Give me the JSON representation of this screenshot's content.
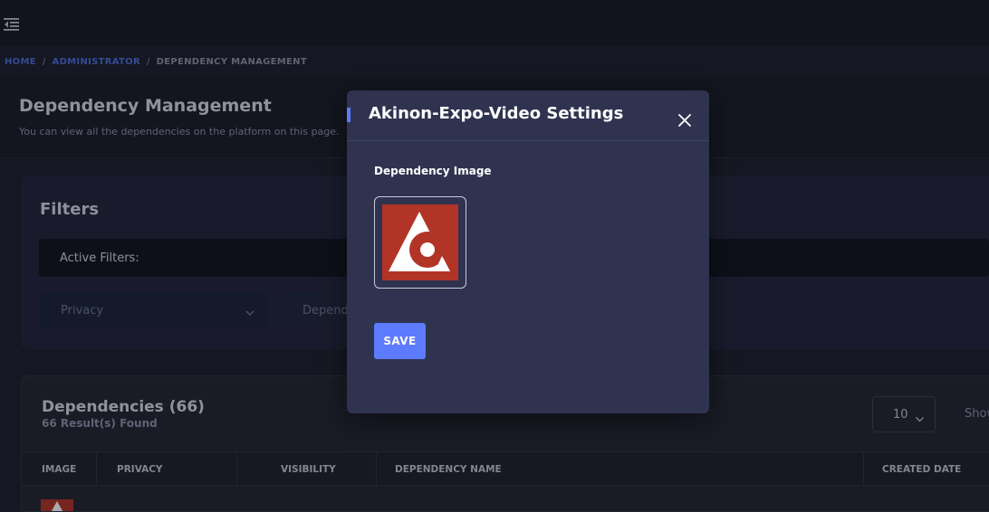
{
  "breadcrumb": {
    "home": "HOME",
    "administrator": "ADMINISTRATOR",
    "current": "DEPENDENCY MANAGEMENT",
    "separator": "/"
  },
  "page": {
    "title": "Dependency Management",
    "subtitle": "You can view all the dependencies on the platform on this page."
  },
  "filters": {
    "title": "Filters",
    "active_filters_label": "Active Filters:",
    "privacy_placeholder": "Privacy",
    "dependency_placeholder": "Depende"
  },
  "dependencies": {
    "title": "Dependencies (66)",
    "result_count": "66 Result(s) Found",
    "page_size": "10",
    "show_label": "Show",
    "columns": [
      "IMAGE",
      "PRIVACY",
      "VISIBILITY",
      "DEPENDENCY NAME",
      "CREATED DATE"
    ]
  },
  "modal": {
    "title": "Akinon-Expo-Video Settings",
    "section_label": "Dependency Image",
    "save_label": "SAVE"
  },
  "colors": {
    "accent": "#5d7bff",
    "logo_red": "#b23426",
    "modal_bg": "#2f3350",
    "link": "#4d6cd8"
  },
  "icons": {
    "menu_toggle": "menu-collapse-icon",
    "close": "close-icon",
    "chevron": "chevron-down-icon",
    "logo": "akinon-logo"
  }
}
